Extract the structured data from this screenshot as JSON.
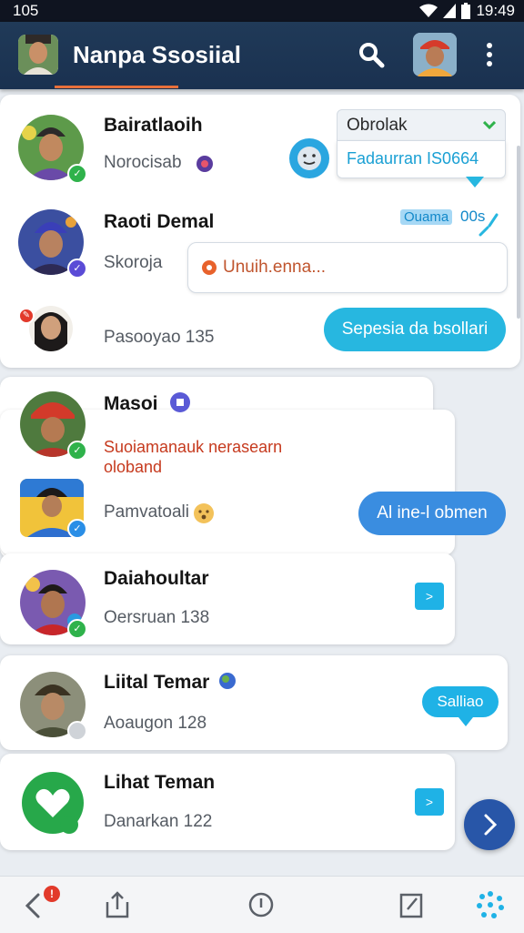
{
  "status_bar": {
    "left_text": "105",
    "time": "19:49"
  },
  "app_bar": {
    "title": "Nanpa Ssosiial"
  },
  "dropdown": {
    "selected": "Obrolak",
    "input_value": "Fadaurran IS0664"
  },
  "contacts": [
    {
      "name": "Bairatlaoih",
      "subtitle": "Norocisab"
    },
    {
      "name": "Raoti Demal",
      "subtitle": "Skoroja",
      "tag": "Ouama",
      "tag_suffix": "00s",
      "input_placeholder": "Unuih.enna..."
    },
    {
      "subtitle": "Pasooyao 135",
      "action_label": "Sepesia da bsollari"
    },
    {
      "name": "Masoi",
      "highlight": "Suoiamanauk nerasearn oloband"
    },
    {
      "subtitle": "Pamvatoali",
      "action_label": "Al ine-l obmen"
    },
    {
      "name": "Daiahoultar",
      "subtitle": "Oersruan 138",
      "arrow": ">"
    },
    {
      "name": "Liital Temar",
      "subtitle": "Aoaugon 128",
      "bubble": "Salliao"
    },
    {
      "name": "Lihat Teman",
      "subtitle": "Danarkan 122",
      "arrow": ">"
    }
  ],
  "fab": {
    "icon": "chevron-right-icon"
  },
  "nav_notification": "!"
}
